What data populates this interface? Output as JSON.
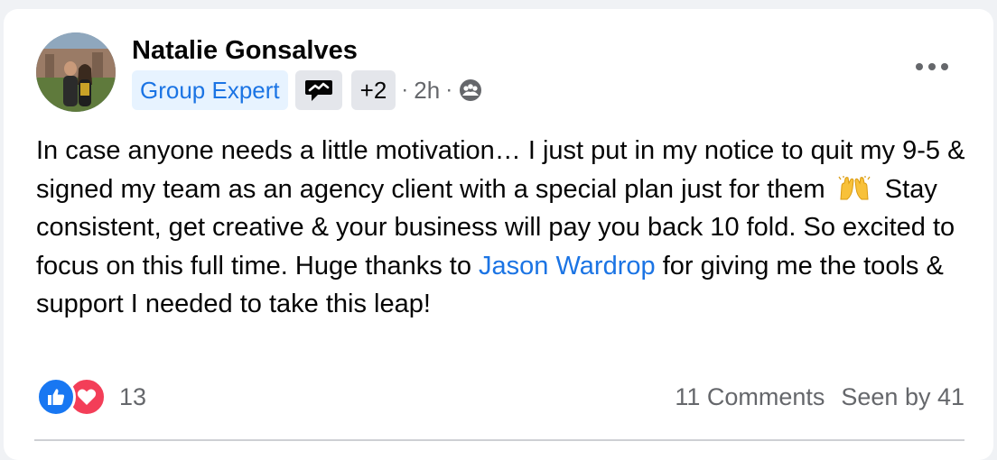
{
  "post": {
    "author": "Natalie Gonsalves",
    "badges": {
      "expert_label": "Group Expert",
      "conversation_icon": "conversation-starter-icon",
      "more_label": "+2"
    },
    "time": "2h",
    "separator": "·",
    "audience_icon": "group-members-icon",
    "more_icon": "more-options-icon",
    "text": {
      "part1": "In case anyone needs a little motivation… I just put in my notice to quit my 9-5 & signed my team as an agency client with a special plan just for them",
      "emoji_icon": "raising-hands-emoji-icon",
      "part2": "Stay consistent, get creative & your business will pay you back 10 fold. So excited to focus on this full time. Huge thanks to",
      "mention": "Jason Wardrop",
      "part3": "for giving me the tools & support I needed to take this leap!"
    },
    "reactions": {
      "icons": [
        "like-reaction-icon",
        "love-reaction-icon"
      ],
      "count": "13"
    },
    "comments": "11 Comments",
    "seen_by": "Seen by 41"
  },
  "colors": {
    "link": "#1b74e4",
    "badge_bg": "#e7f3ff",
    "like": "#1877f2",
    "love": "#f33e58",
    "secondary_text": "#65676b"
  }
}
